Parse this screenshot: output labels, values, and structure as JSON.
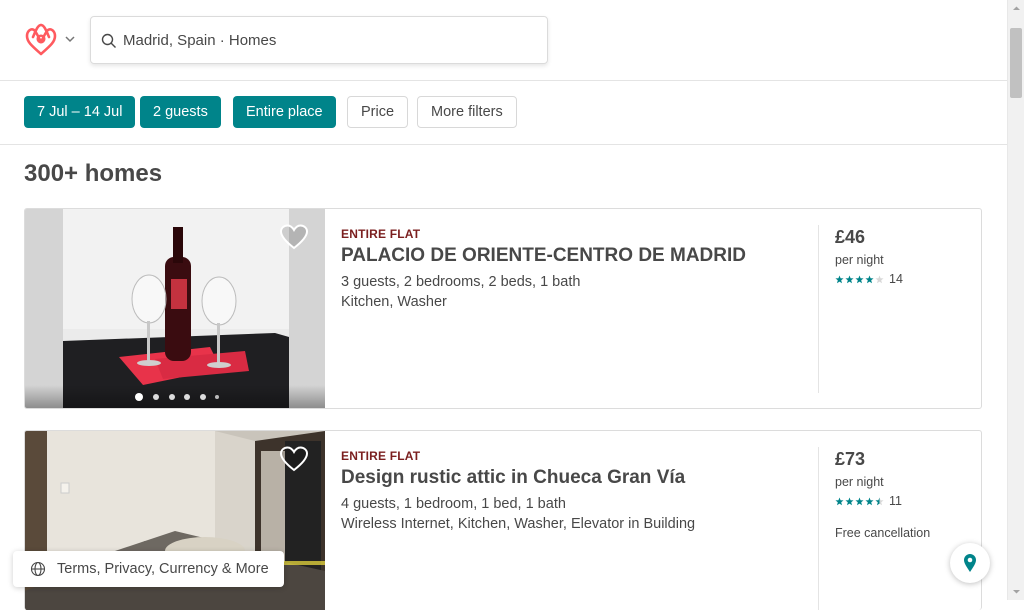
{
  "search": {
    "value": "Madrid, Spain · Homes"
  },
  "filters": [
    {
      "label": "7 Jul – 14 Jul",
      "active": true
    },
    {
      "label": "2 guests",
      "active": true
    },
    {
      "label": "Entire place",
      "active": true
    },
    {
      "label": "Price",
      "active": false
    },
    {
      "label": "More filters",
      "active": false
    }
  ],
  "results": {
    "heading": "300+ homes"
  },
  "listings": [
    {
      "property_type": "ENTIRE FLAT",
      "title": "PALACIO DE ORIENTE-CENTRO DE MADRID",
      "details": "3 guests, 2 bedrooms, 2 beds, 1 bath",
      "amenities": "Kitchen, Washer",
      "price": "£46",
      "price_unit": "per night",
      "rating_stars": 4,
      "review_count": "14",
      "free_cancellation": ""
    },
    {
      "property_type": "ENTIRE FLAT",
      "title": "Design rustic attic in Chueca Gran Vía",
      "details": "4 guests, 1 bedroom, 1 bed, 1 bath",
      "amenities": "Wireless Internet, Kitchen, Washer, Elevator in Building",
      "price": "£73",
      "price_unit": "per night",
      "rating_stars": 4.5,
      "review_count": "11",
      "free_cancellation": "Free cancellation"
    }
  ],
  "footer": {
    "label": "Terms, Privacy, Currency & More"
  },
  "colors": {
    "brand": "#ff5a5f",
    "accent": "#00848a",
    "title_type": "#7b1f1f"
  },
  "icons": [
    "airbnb-logo-icon",
    "chevron-down-icon",
    "search-icon",
    "heart-icon",
    "star-icon",
    "globe-icon",
    "map-pin-icon"
  ]
}
